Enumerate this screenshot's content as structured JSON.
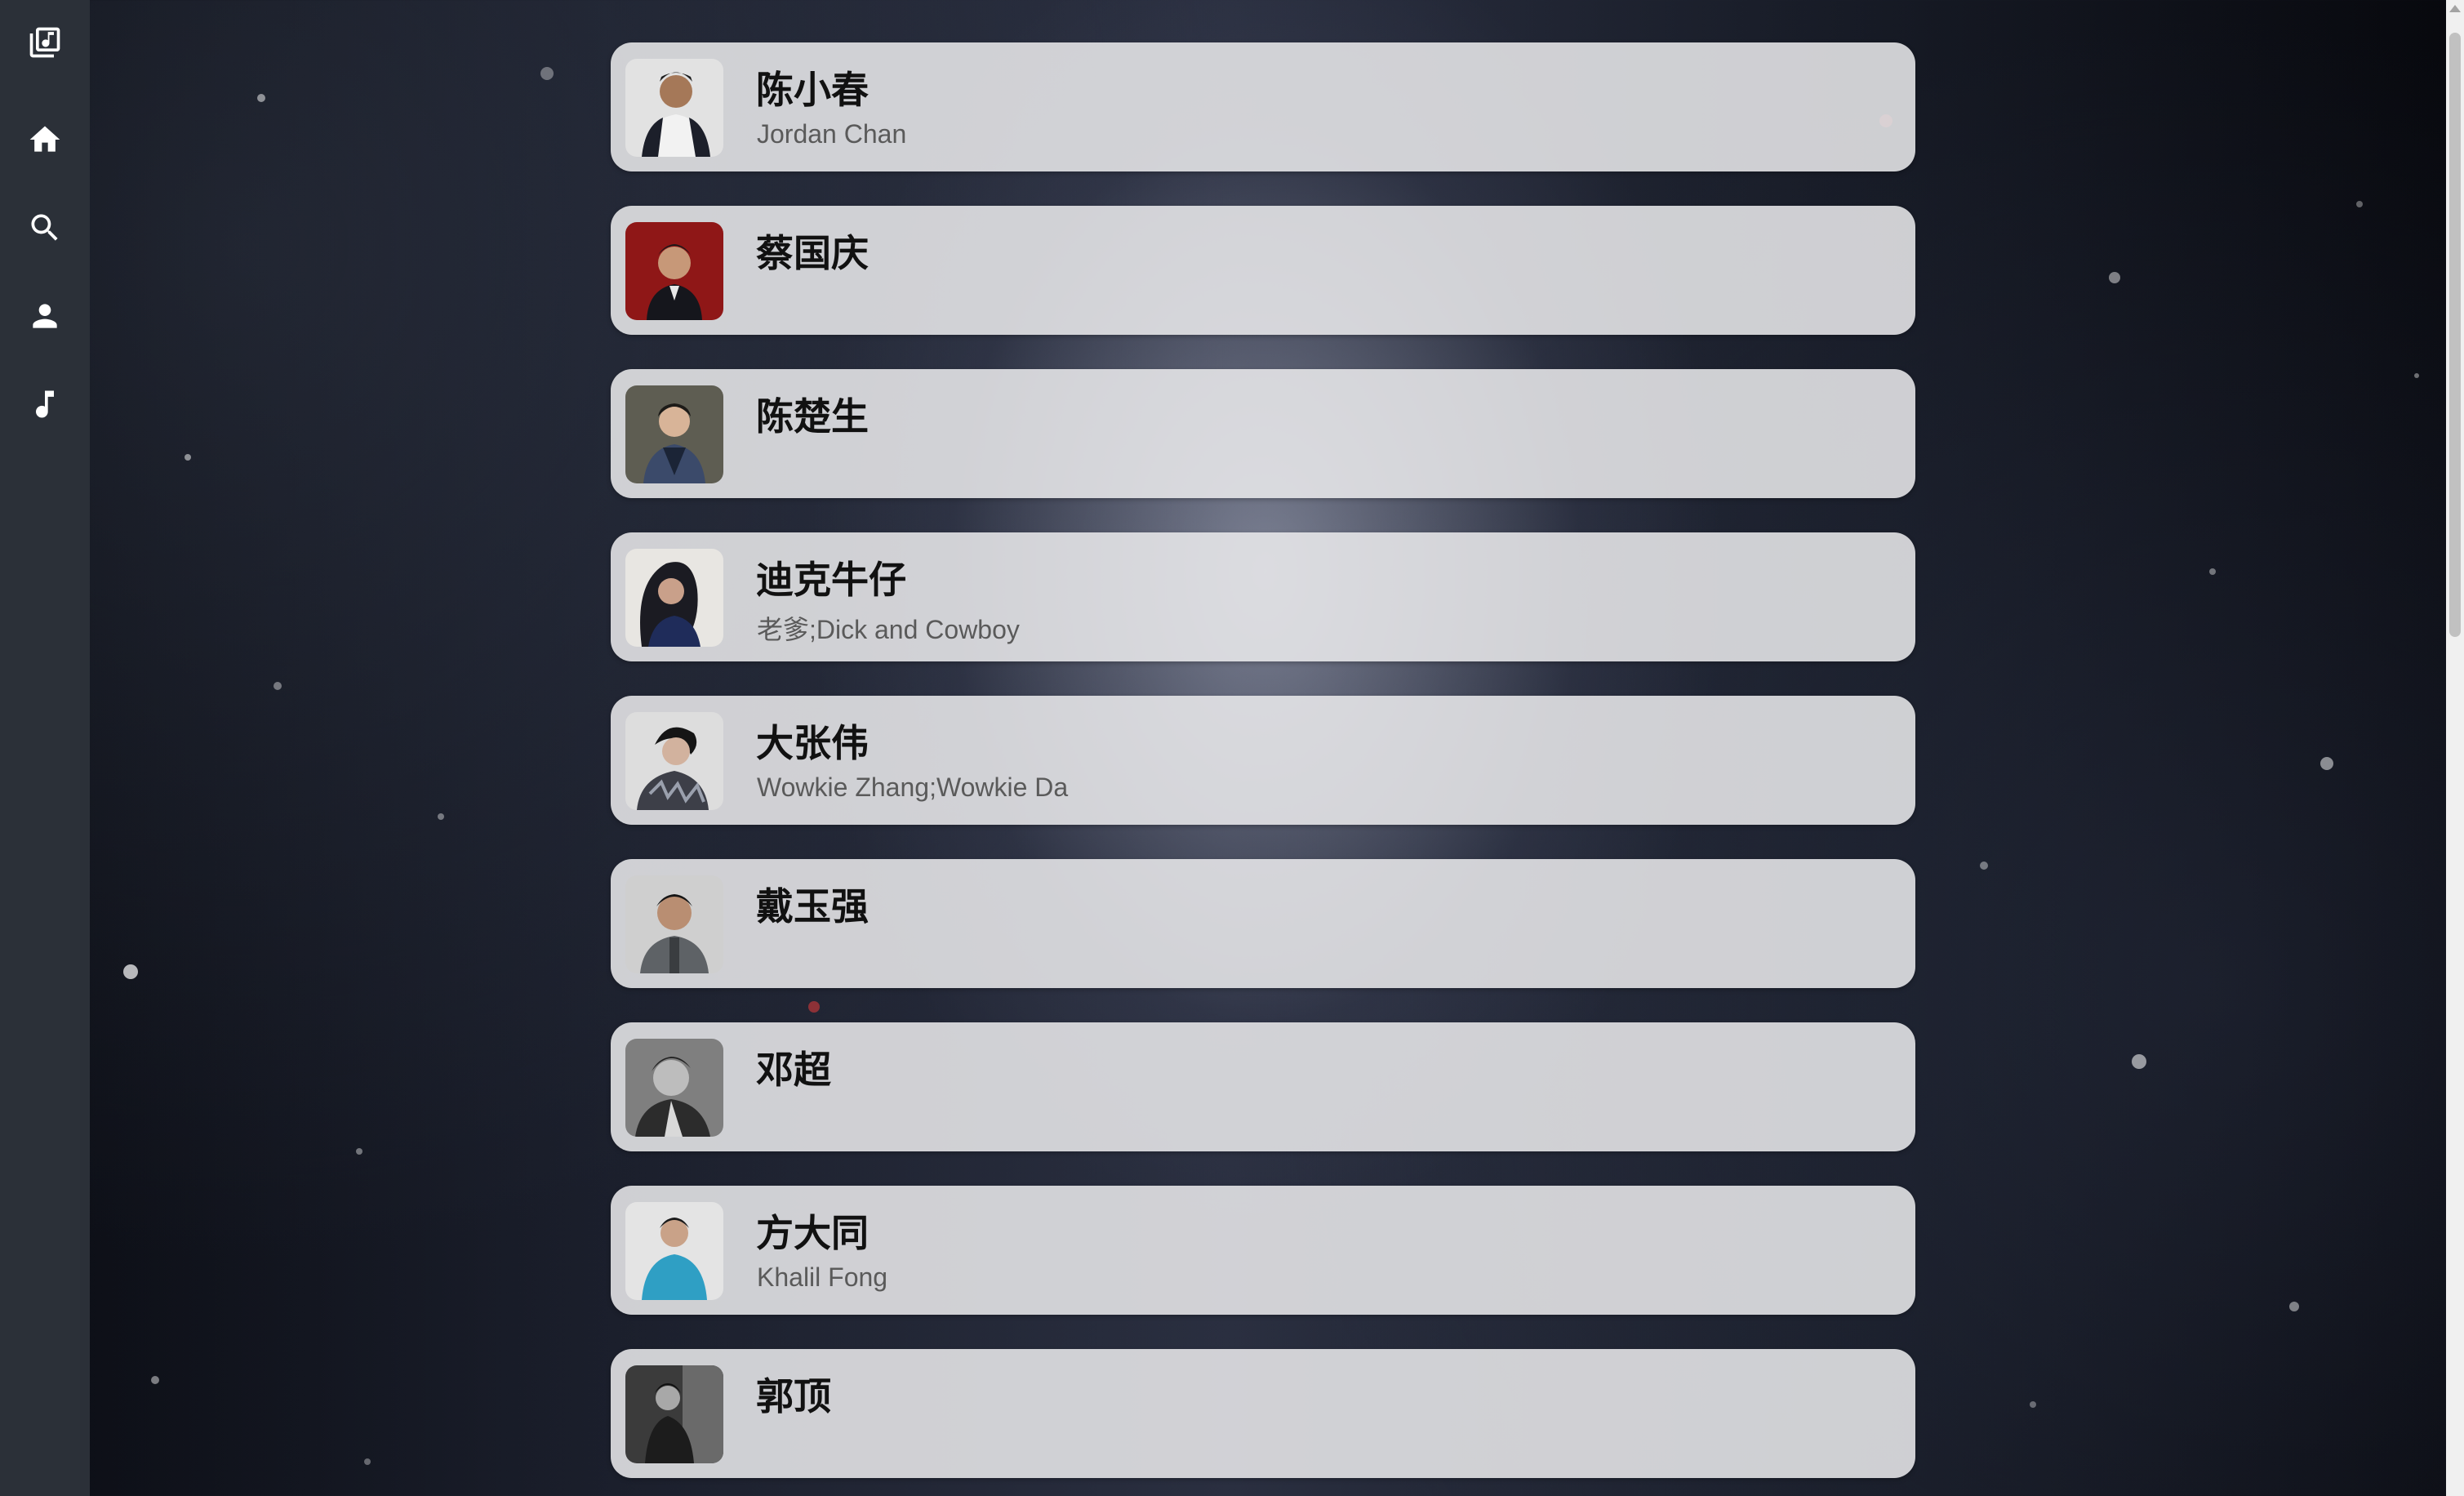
{
  "sidebar": {
    "items": [
      {
        "name": "library-music-icon"
      },
      {
        "name": "home-icon"
      },
      {
        "name": "search-icon"
      },
      {
        "name": "person-icon"
      },
      {
        "name": "music-note-icon"
      }
    ]
  },
  "artists": [
    {
      "name": "陈小春",
      "alias": "Jordan Chan",
      "avatar_color": "#d9d9d9"
    },
    {
      "name": "蔡国庆",
      "alias": "",
      "avatar_color": "#9c1c1c"
    },
    {
      "name": "陈楚生",
      "alias": "",
      "avatar_color": "#5b5b4e"
    },
    {
      "name": "迪克牛仔",
      "alias": "老爹;Dick and Cowboy",
      "avatar_color": "#e6e4e0"
    },
    {
      "name": "大张伟",
      "alias": "Wowkie Zhang;Wowkie Da",
      "avatar_color": "#dcdcdc"
    },
    {
      "name": "戴玉强",
      "alias": "",
      "avatar_color": "#c9c9c9"
    },
    {
      "name": "邓超",
      "alias": "",
      "avatar_color": "#8a8a8a"
    },
    {
      "name": "方大同",
      "alias": "Khalil Fong",
      "avatar_color": "#e3e3e3"
    },
    {
      "name": "郭顶",
      "alias": "",
      "avatar_color": "#3a3a3a"
    }
  ]
}
